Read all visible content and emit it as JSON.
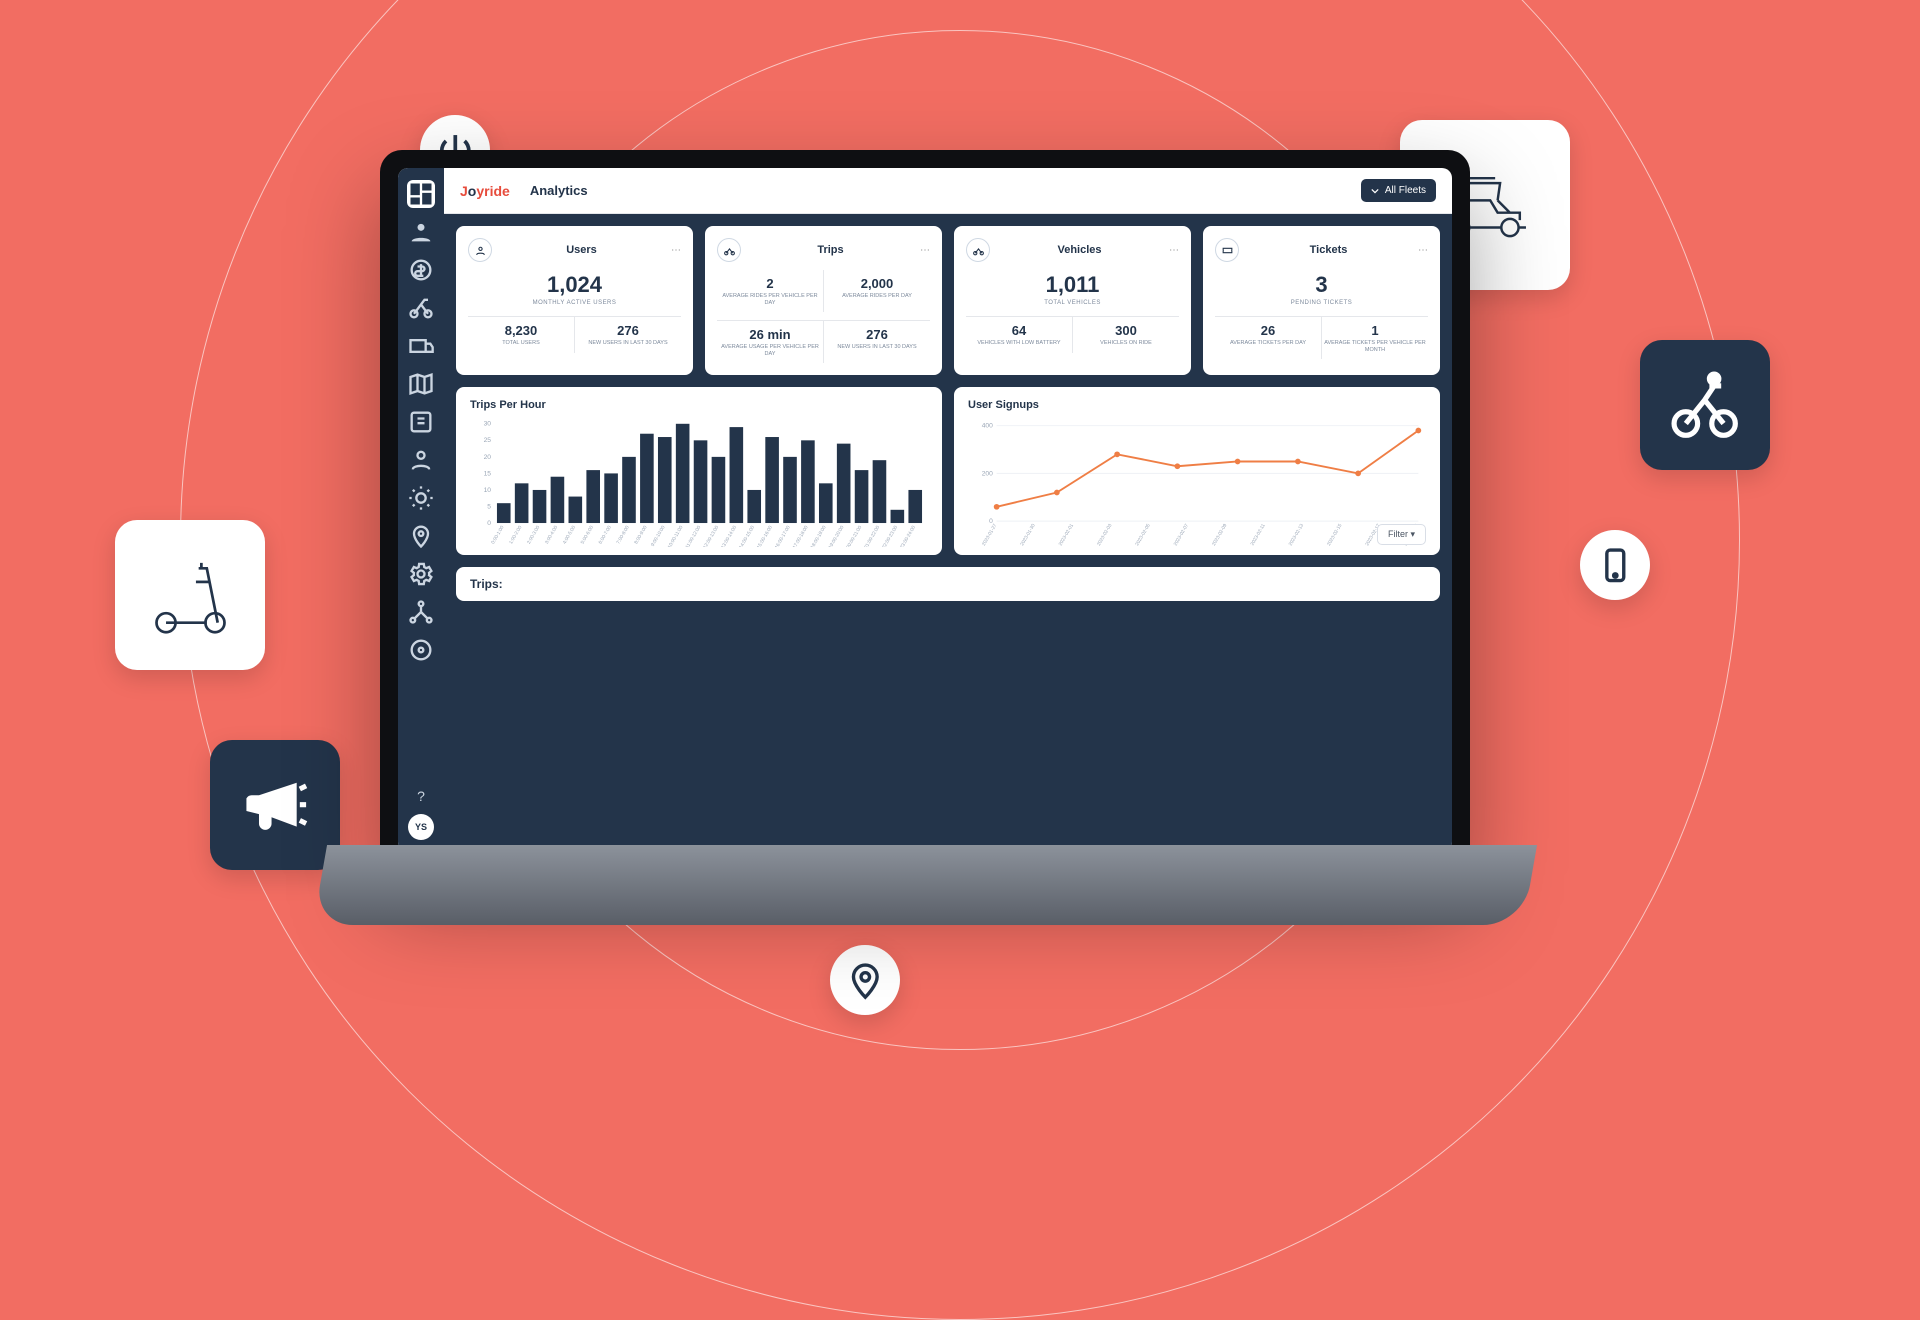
{
  "brand": "Joyride",
  "page_title": "Analytics",
  "fleet_selector": {
    "label": "All Fleets"
  },
  "sidebar": {
    "items": [
      "dashboard",
      "riders",
      "revenue",
      "vehicles",
      "operations",
      "map",
      "tickets",
      "users",
      "rewards",
      "geofence",
      "settings-cog",
      "org",
      "preferences"
    ],
    "avatar": "YS"
  },
  "cards": {
    "users": {
      "title": "Users",
      "main": {
        "value": "1,024",
        "caption": "MONTHLY ACTIVE USERS"
      },
      "cells": [
        {
          "value": "8,230",
          "label": "Total Users"
        },
        {
          "value": "276",
          "label": "New Users in Last 30 Days"
        }
      ]
    },
    "trips": {
      "title": "Trips",
      "cells": [
        {
          "value": "2",
          "label": "Average Rides Per Vehicle Per Day"
        },
        {
          "value": "2,000",
          "label": "Average Rides Per Day"
        },
        {
          "value": "26 min",
          "label": "Average Usage Per Vehicle Per Day"
        },
        {
          "value": "276",
          "label": "New Users in Last 30 Days"
        }
      ]
    },
    "vehicles": {
      "title": "Vehicles",
      "main": {
        "value": "1,011",
        "caption": "TOTAL VEHICLES"
      },
      "cells": [
        {
          "value": "64",
          "label": "Vehicles with Low Battery"
        },
        {
          "value": "300",
          "label": "Vehicles on Ride"
        }
      ]
    },
    "tickets": {
      "title": "Tickets",
      "main": {
        "value": "3",
        "caption": "PENDING TICKETS"
      },
      "cells": [
        {
          "value": "26",
          "label": "Average Tickets Per Day"
        },
        {
          "value": "1",
          "label": "Average Tickets Per Vehicle Per Month"
        }
      ]
    }
  },
  "chart_data": [
    {
      "type": "bar",
      "title": "Trips Per Hour",
      "ylabel": "",
      "xlabel": "",
      "ylim": [
        0,
        30
      ],
      "yticks": [
        0,
        5,
        10,
        15,
        20,
        25,
        30
      ],
      "categories": [
        "0:00-1:00",
        "1:00-2:00",
        "2:00-3:00",
        "3:00-4:00",
        "4:00-5:00",
        "5:00-6:00",
        "6:00-7:00",
        "7:00-8:00",
        "8:00-9:00",
        "9:00-10:00",
        "10:00-11:00",
        "11:00-12:00",
        "12:00-13:00",
        "13:00-14:00",
        "14:00-15:00",
        "15:00-16:00",
        "16:00-17:00",
        "17:00-18:00",
        "18:00-19:00",
        "19:00-20:00",
        "20:00-21:00",
        "21:00-22:00",
        "22:00-23:00",
        "23:00-24:00"
      ],
      "values": [
        6,
        12,
        10,
        14,
        8,
        16,
        15,
        20,
        27,
        26,
        30,
        25,
        20,
        29,
        10,
        26,
        20,
        25,
        12,
        24,
        16,
        19,
        4,
        10
      ]
    },
    {
      "type": "line",
      "title": "User Signups",
      "ylabel": "",
      "xlabel": "",
      "ylim": [
        0,
        400
      ],
      "yticks": [
        0,
        200,
        400
      ],
      "categories": [
        "2023-01-27",
        "2023-01-30",
        "2023-02-01",
        "2023-02-03",
        "2023-02-05",
        "2023-02-07",
        "2023-02-09",
        "2023-02-11",
        "2023-02-13",
        "2023-02-15",
        "2023-02-17",
        "2023-02-19"
      ],
      "x": [
        0,
        1,
        2,
        3,
        4,
        5,
        6,
        7
      ],
      "values": [
        60,
        120,
        280,
        230,
        250,
        250,
        200,
        380
      ]
    }
  ],
  "signups_filter_label": "Filter",
  "trips_strip_label": "Trips:",
  "colors": {
    "accent": "#f26d62",
    "navy": "#23344a",
    "bar": "#23344a",
    "line": "#ef7e45"
  }
}
